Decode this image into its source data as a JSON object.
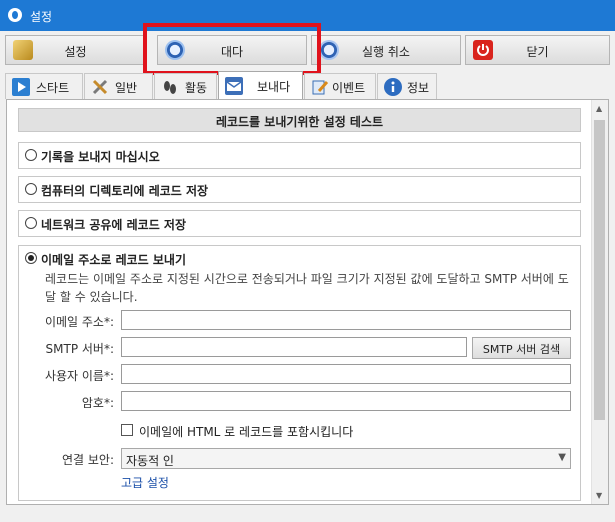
{
  "window": {
    "title": "설정"
  },
  "toolbar": {
    "settings_label": "설정",
    "wait_label": "대다",
    "cancel_label": "실행 취소",
    "close_label": "닫기"
  },
  "tabs": [
    {
      "label": "스타트",
      "icon": "play-icon"
    },
    {
      "label": "일반",
      "icon": "tools-icon"
    },
    {
      "label": "활동",
      "icon": "footprint-icon"
    },
    {
      "label": "보내다",
      "icon": "mail-icon"
    },
    {
      "label": "이벤트",
      "icon": "edit-icon"
    },
    {
      "label": "정보",
      "icon": "info-icon"
    }
  ],
  "main": {
    "section_title": "레코드를 보내기위한 설정 테스트",
    "options": {
      "no_send": "기록을 보내지 마십시오",
      "save_dir": "컴퓨터의 디렉토리에 레코드 저장",
      "save_network": "네트워크 공유에 레코드 저장",
      "send_email": "이메일 주소로 레코드 보내기"
    },
    "email": {
      "description": "레코드는 이메일 주소로 지정된 시간으로 전송되거나 파일 크기가 지정된 값에 도달하고 SMTP 서버에 도달 할 수 있습니다.",
      "address_label": "이메일 주소*:",
      "smtp_label": "SMTP 서버*:",
      "smtp_search": "SMTP 서버 검색",
      "username_label": "사용자 이름*:",
      "password_label": "암호*:",
      "html_checkbox": "이메일에 HTML 로 레코드를 포함시킵니다",
      "security_label": "연결 보안:",
      "security_value": "자동적 인",
      "advanced_link": "고급 설정"
    }
  },
  "colors": {
    "titlebar": "#1e79d4",
    "highlight": "#e0121c",
    "link": "#1b4fa8"
  }
}
